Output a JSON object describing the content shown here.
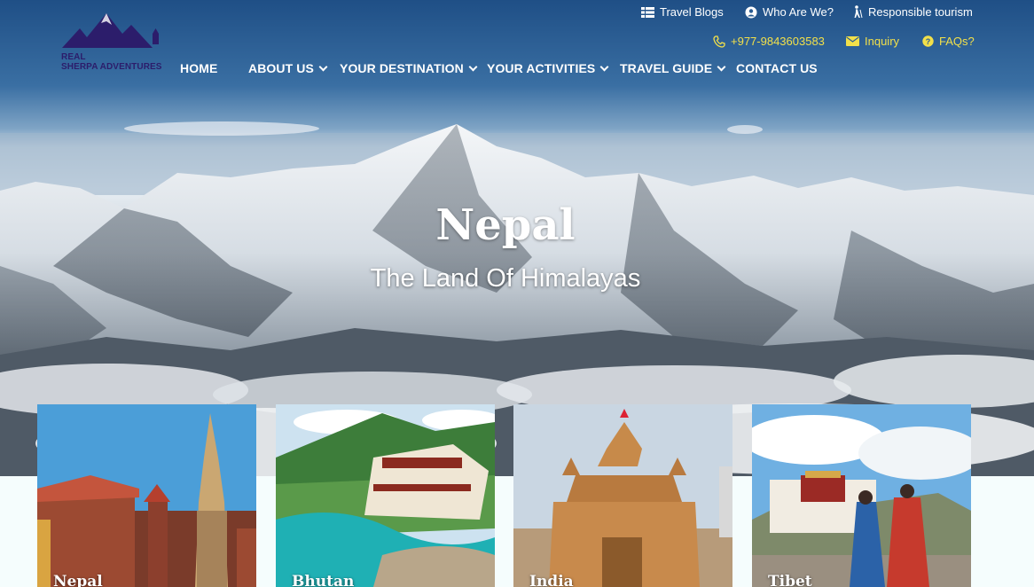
{
  "brand": {
    "logo_line1": "REAL",
    "logo_line2": "SHERPA ADVENTURES",
    "color": "#2c1d6b"
  },
  "util_nav": {
    "travel_blogs": "Travel Blogs",
    "who_are_we": "Who Are We?",
    "responsible": "Responsible tourism",
    "phone": "+977-9843603583",
    "inquiry": "Inquiry",
    "faqs": "FAQs?",
    "accent_color": "#f2e04a"
  },
  "main_nav": {
    "home": "HOME",
    "about": "ABOUT US",
    "destination": "YOUR DESTINATION",
    "activities": "YOUR ACTIVITIES",
    "guide": "TRAVEL GUIDE",
    "contact": "CONTACT US"
  },
  "hero": {
    "title": "Nepal",
    "subtitle": "The Land Of Himalayas"
  },
  "destinations": [
    {
      "label": "Nepal"
    },
    {
      "label": "Bhutan"
    },
    {
      "label": "India"
    },
    {
      "label": "Tibet"
    }
  ]
}
